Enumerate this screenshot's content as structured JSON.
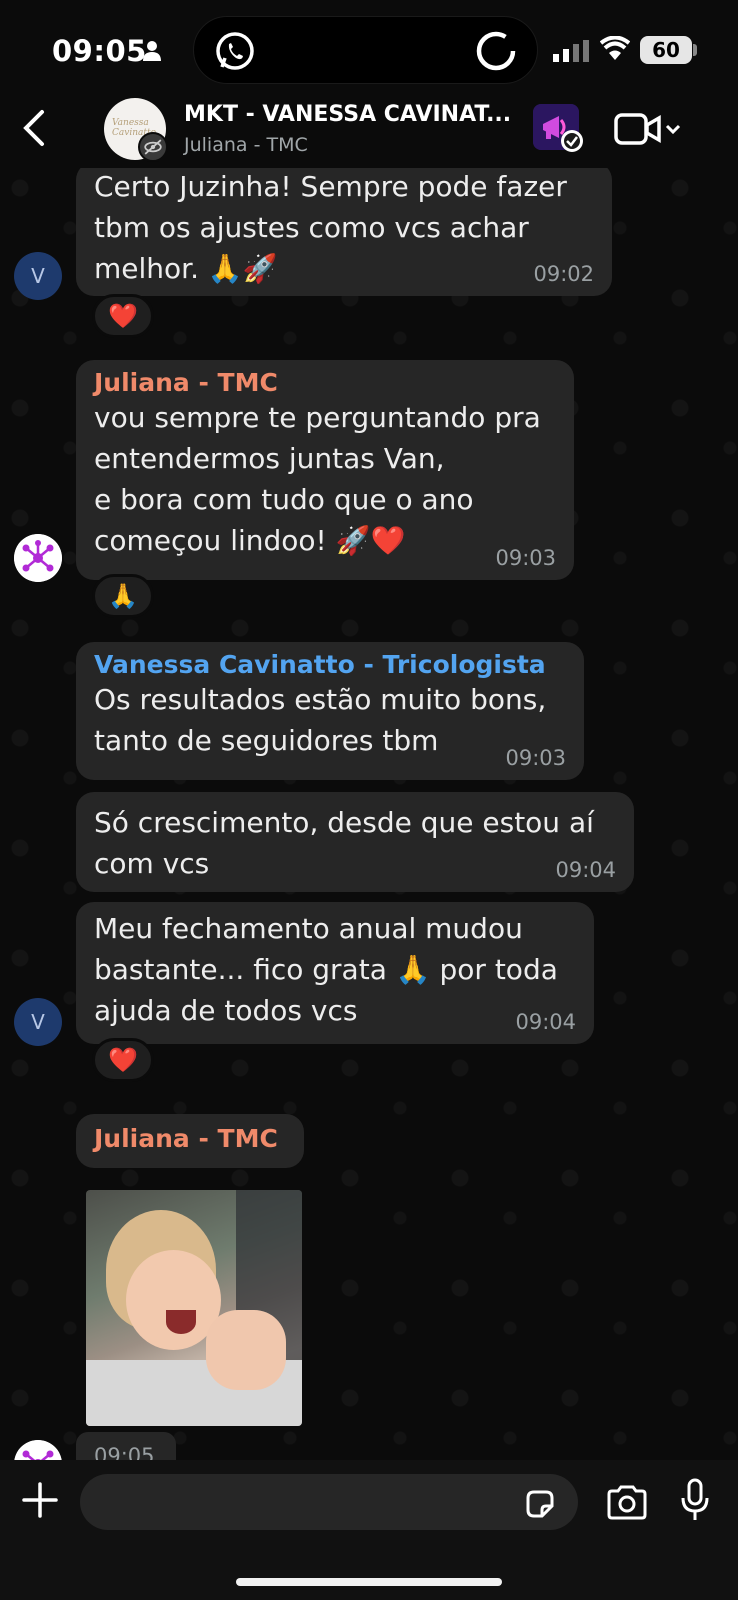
{
  "status_bar": {
    "time": "09:05",
    "battery": "60"
  },
  "header": {
    "title": "MKT - VANESSA CAVINAT...",
    "subtitle": "Juliana - TMC"
  },
  "messages": [
    {
      "text": "Certo Juzinha! Sempre pode fazer\ntbm os ajustes como vcs achar\nmelhor. 🙏🚀",
      "time": "09:02",
      "reaction": "❤️",
      "avatar": "V"
    },
    {
      "sender": "Juliana - TMC",
      "sender_color": "#f08a6a",
      "text": "vou sempre te perguntando pra\nentendermos juntas Van,\ne bora com tudo que o ano\ncomeçou lindoo! 🚀❤️",
      "time": "09:03",
      "reaction": "🙏"
    },
    {
      "sender": "Vanessa Cavinatto - Tricologista",
      "sender_color": "#53a4f0",
      "text": "Os resultados estão muito bons,\ntanto de seguidores tbm",
      "time": "09:03"
    },
    {
      "text": "Só crescimento, desde que estou aí\ncom vcs",
      "time": "09:04"
    },
    {
      "text": "Meu fechamento anual mudou\nbastante... fico grata 🙏 por toda\najuda de todos vcs",
      "time": "09:04",
      "reaction": "❤️",
      "avatar": "V"
    },
    {
      "sender": "Juliana - TMC",
      "sender_color": "#f08a6a",
      "media": "child-clapping-gif",
      "time": "09:05"
    }
  ],
  "composer": {
    "placeholder": ""
  },
  "colors": {
    "bubble": "#262626",
    "background": "#0b0b0b"
  }
}
